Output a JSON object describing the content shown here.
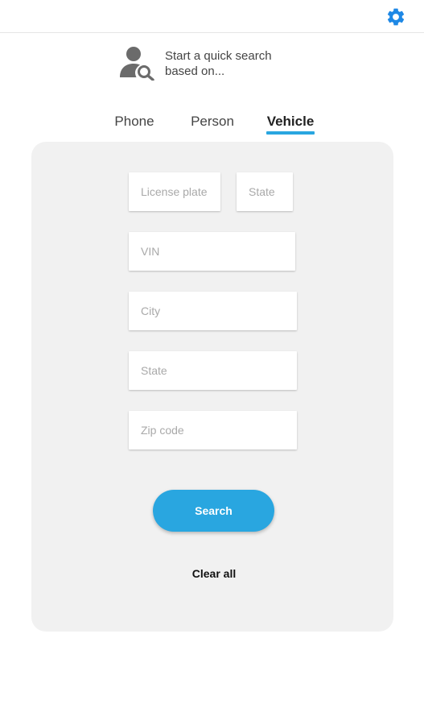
{
  "header": {
    "settings_icon": "gear-icon",
    "accent": "#1e88e5"
  },
  "hero": {
    "icon": "person-search-icon",
    "line1": "Start a quick search",
    "line2": "based on..."
  },
  "tabs": [
    {
      "label": "Phone",
      "active": false
    },
    {
      "label": "Person",
      "active": false
    },
    {
      "label": "Vehicle",
      "active": true
    }
  ],
  "form": {
    "license_plate_placeholder": "License plate",
    "state_placeholder_top": "State",
    "vin_placeholder": "VIN",
    "city_placeholder": "City",
    "state_placeholder": "State",
    "zip_placeholder": "Zip code",
    "search_label": "Search",
    "clear_label": "Clear all"
  },
  "colors": {
    "primary": "#29a6e0",
    "panel_bg": "#f1f1f1"
  }
}
